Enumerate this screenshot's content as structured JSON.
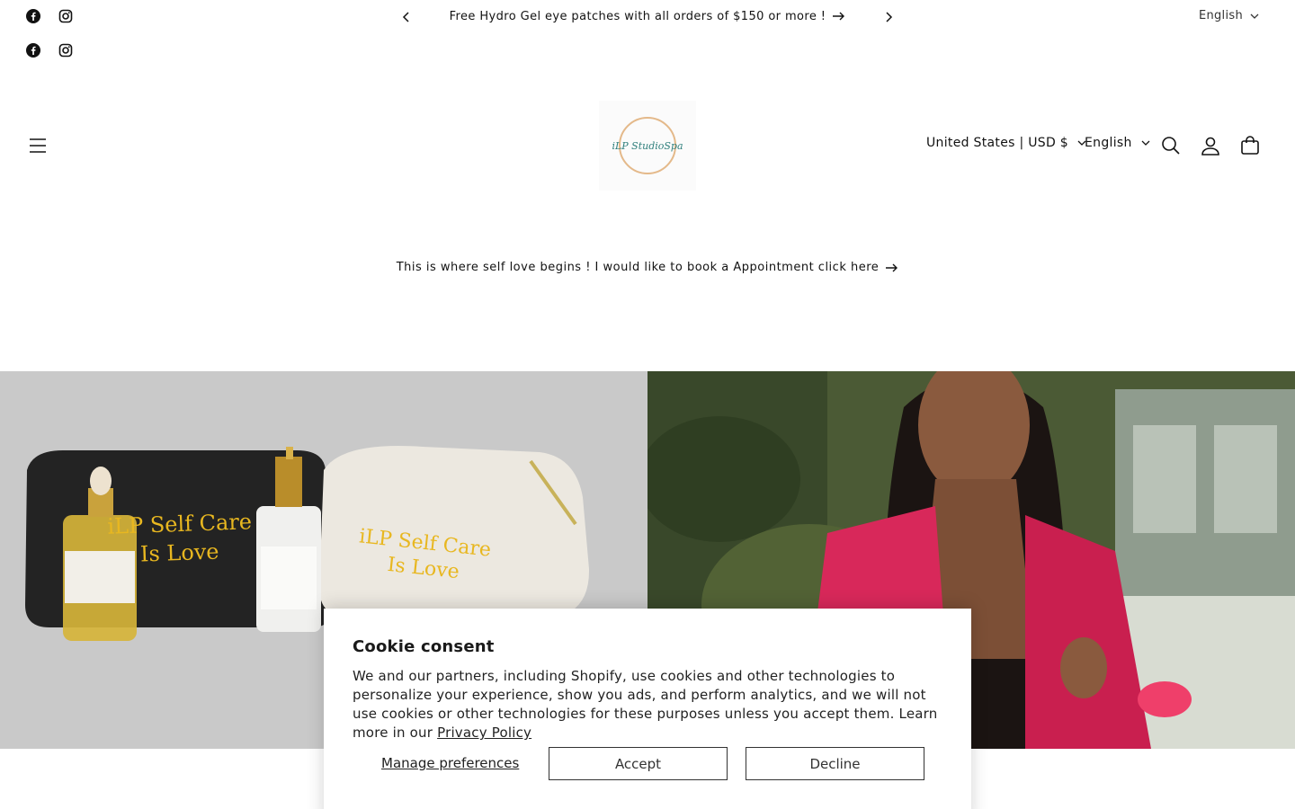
{
  "announcement": {
    "message": "Free Hydro Gel eye patches with all orders of $150 or more !",
    "language": "English"
  },
  "social": [
    "facebook-icon",
    "instagram-icon"
  ],
  "header": {
    "logo_text": "iLP StudioSpa",
    "country": "United States | USD $",
    "language": "English"
  },
  "promo": {
    "text": "This is where self love begins ! I would like to book a Appointment click here"
  },
  "tiles": {
    "left": {
      "bag_text_line1": "iLP Self Care",
      "bag_text_line2": "Is Love"
    }
  },
  "cookie": {
    "title": "Cookie consent",
    "body": "We and our partners, including Shopify, use cookies and other technologies to personalize your experience, show you ads, and perform analytics, and we will not use cookies or other technologies for these purposes unless you accept them. Learn more in our",
    "policy_link": "Privacy Policy",
    "manage": "Manage preferences",
    "accept": "Accept",
    "decline": "Decline"
  },
  "colors": {
    "text": "#121212",
    "logo_teal": "#2f7f7c",
    "logo_gold": "#e4b98a",
    "gold_print": "#e8b720",
    "robe_pink": "#d8285a"
  }
}
